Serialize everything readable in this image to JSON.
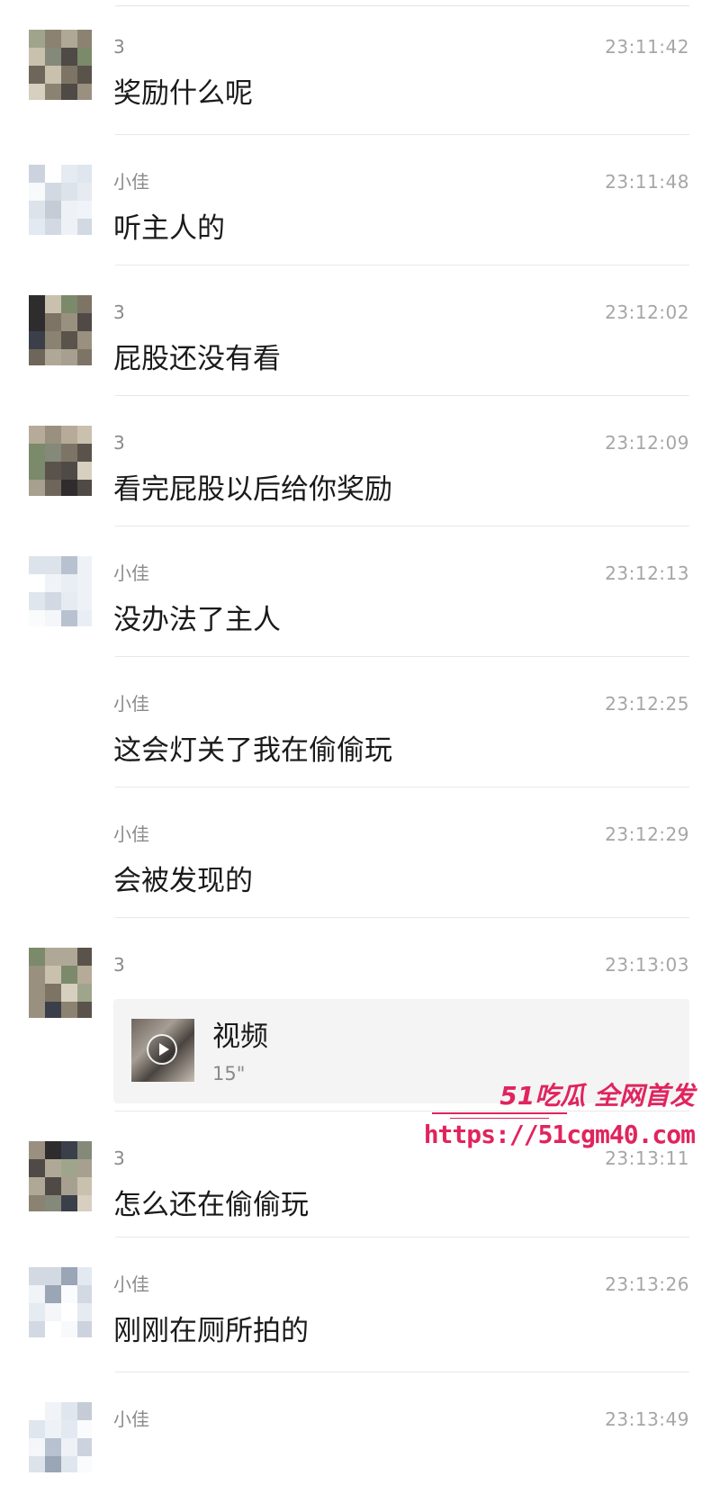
{
  "messages": [
    {
      "sender": "3",
      "time": "23:11:42",
      "text": "奖励什么呢",
      "avatar": "user3"
    },
    {
      "sender": "小佳",
      "time": "23:11:48",
      "text": "听主人的",
      "avatar": "xiaojia"
    },
    {
      "sender": "3",
      "time": "23:12:02",
      "text": "屁股还没有看",
      "avatar": "user3"
    },
    {
      "sender": "3",
      "time": "23:12:09",
      "text": "看完屁股以后给你奖励",
      "avatar": "user3"
    },
    {
      "sender": "小佳",
      "time": "23:12:13",
      "text": "没办法了主人",
      "avatar": "xiaojia"
    },
    {
      "sender": "小佳",
      "time": "23:12:25",
      "text": "这会灯关了我在偷偷玩",
      "avatar": "none"
    },
    {
      "sender": "小佳",
      "time": "23:12:29",
      "text": "会被发现的",
      "avatar": "none"
    },
    {
      "sender": "3",
      "time": "23:13:03",
      "video": {
        "title": "视频",
        "duration": "15\""
      },
      "avatar": "user3"
    },
    {
      "sender": "3",
      "time": "23:13:11",
      "text": "怎么还在偷偷玩",
      "avatar": "user3"
    },
    {
      "sender": "小佳",
      "time": "23:13:26",
      "text": "刚刚在厕所拍的",
      "avatar": "xiaojia"
    },
    {
      "sender": "小佳",
      "time": "23:13:49",
      "text": "",
      "avatar": "xiaojia"
    }
  ],
  "watermark": {
    "brand": "51吃瓜 全网首发",
    "url": "https://51cgm40.com"
  },
  "colors": {
    "accent": "#e0245e",
    "sender": "#8a8a8a",
    "time": "#a6a6a6",
    "divider": "#e8e8e8"
  }
}
